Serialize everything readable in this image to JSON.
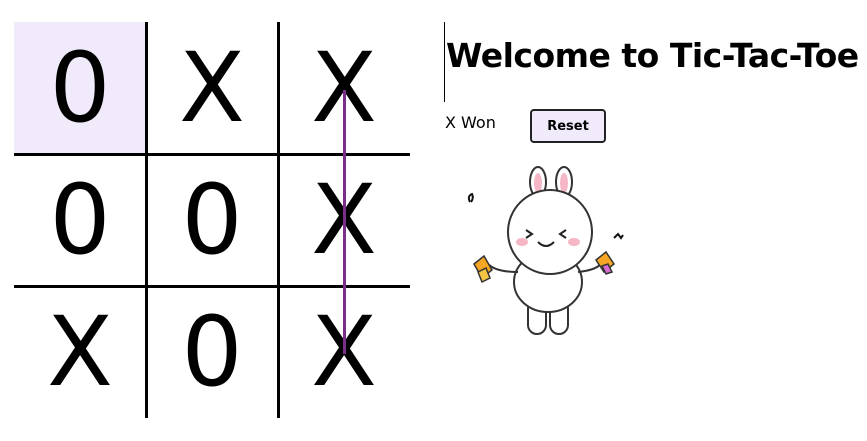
{
  "game": {
    "title": "Welcome to Tic-Tac-Toe",
    "status": "X Won",
    "reset_label": "Reset",
    "board": [
      "0",
      "X",
      "X",
      "0",
      "0",
      "X",
      "X",
      "0",
      "X"
    ],
    "winning_cells": [
      2,
      5,
      8
    ],
    "highlighted_cell": 0
  },
  "sticker": {
    "subject": "celebrating bunny"
  },
  "colors": {
    "highlight": "#f1eafb",
    "win_line": "#7b2d8b",
    "button_bg": "#f1eafb"
  }
}
